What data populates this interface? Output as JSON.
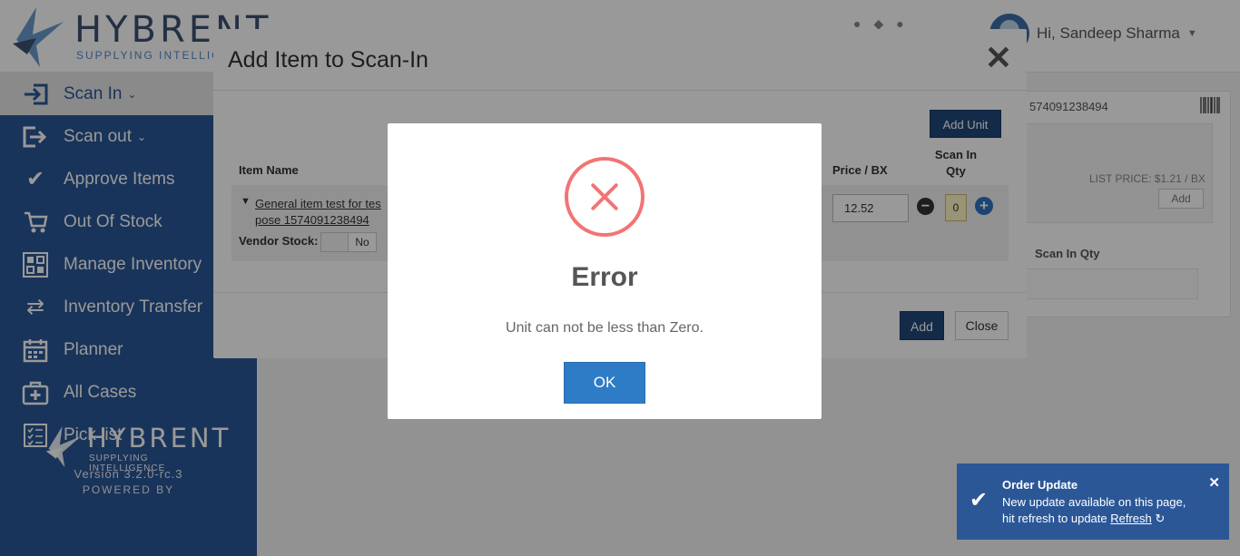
{
  "header": {
    "logo_word": "HYBRENT",
    "logo_tagline": "SUPPLYING INTELLIGENCE",
    "user_greeting": "Hi, Sandeep Sharma"
  },
  "sidebar": {
    "items": [
      {
        "label": "Scan In",
        "icon": "scan-in-icon"
      },
      {
        "label": "Scan out",
        "icon": "scan-out-icon"
      },
      {
        "label": "Approve Items",
        "icon": "check-icon"
      },
      {
        "label": "Out Of Stock",
        "icon": "cart-icon"
      },
      {
        "label": "Manage Inventory",
        "icon": "inventory-icon"
      },
      {
        "label": "Inventory Transfer",
        "icon": "transfer-icon"
      },
      {
        "label": "Planner",
        "icon": "calendar-icon"
      },
      {
        "label": "All Cases",
        "icon": "medical-case-icon"
      },
      {
        "label": "Pick list",
        "icon": "checklist-icon"
      }
    ],
    "version": "Version 3.2.0-rc.3",
    "powered_by": "POWERED BY",
    "footer_logo_word": "HYBRENT",
    "footer_logo_tagline": "SUPPLYING INTELLIGENCE"
  },
  "background_panel": {
    "barcode_value": "574091238494",
    "list_price": "LIST PRICE:  $1.21 / BX",
    "add_label": "Add",
    "scan_in_qty_label": "Scan In Qty"
  },
  "modal": {
    "title": "Add Item to Scan-In",
    "add_unit_label": "Add Unit",
    "columns": {
      "item_name": "Item Name",
      "price": "Price / BX",
      "scan_in_qty": "Scan In Qty"
    },
    "row": {
      "item_link": "General item test for tes pose 1574091238494",
      "vendor_stock_label": "Vendor Stock:",
      "vendor_stock_value": "No",
      "price": "12.52",
      "qty": "0"
    },
    "add_label": "Add",
    "close_label": "Close"
  },
  "alert": {
    "title": "Error",
    "message": "Unit can not be less than Zero.",
    "ok_label": "OK"
  },
  "toast": {
    "title": "Order Update",
    "body_line1": "New update available on this page,",
    "body_line2_prefix": "hit refresh to update ",
    "link": "Refresh"
  },
  "colors": {
    "brand": "#2b5797",
    "primary_button": "#20497a",
    "ok_button": "#2f7cc6",
    "error": "#f27474"
  }
}
